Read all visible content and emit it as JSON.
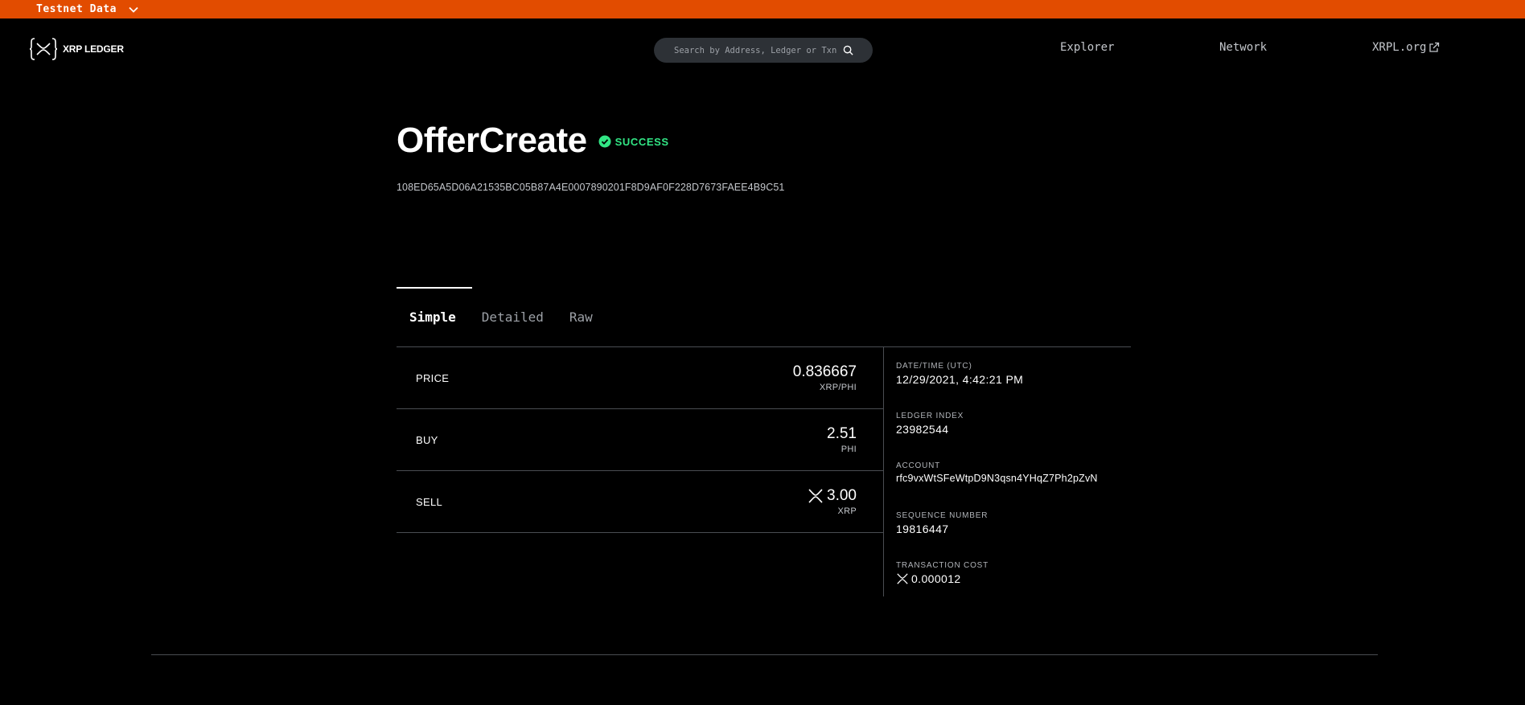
{
  "banner": {
    "network_label": "Testnet Data",
    "background_color": "#e24c00"
  },
  "header": {
    "logo_text": "XRP LEDGER",
    "search_placeholder": "Search by Address, Ledger or Txn",
    "nav": {
      "explorer": "Explorer",
      "network": "Network",
      "xrpl": "XRPL.org"
    }
  },
  "transaction": {
    "type": "OfferCreate",
    "status": "SUCCESS",
    "status_color": "#32e685",
    "hash": "108ED65A5D06A21535BC05B87A4E0007890201F8D9AF0F228D7673FAEE4B9C51"
  },
  "tabs": [
    "Simple",
    "Detailed",
    "Raw"
  ],
  "active_tab": "Simple",
  "simple": {
    "price": {
      "label": "PRICE",
      "amount": "0.836667",
      "currency": "XRP/PHI"
    },
    "buy": {
      "label": "BUY",
      "amount": "2.51",
      "currency": "PHI"
    },
    "sell": {
      "label": "SELL",
      "amount": "3.00",
      "currency": "XRP",
      "icon": "xrp-icon"
    }
  },
  "details": {
    "datetime": {
      "label": "DATE/TIME (UTC)",
      "value": "12/29/2021, 4:42:21 PM"
    },
    "ledger_index": {
      "label": "LEDGER INDEX",
      "value": "23982544"
    },
    "account": {
      "label": "ACCOUNT",
      "value": "rfc9vxWtSFeWtpD9N3qsn4YHqZ7Ph2pZvN"
    },
    "sequence": {
      "label": "SEQUENCE NUMBER",
      "value": "19816447"
    },
    "fee": {
      "label": "TRANSACTION COST",
      "value": "0.000012",
      "icon": "xrp-icon"
    }
  }
}
